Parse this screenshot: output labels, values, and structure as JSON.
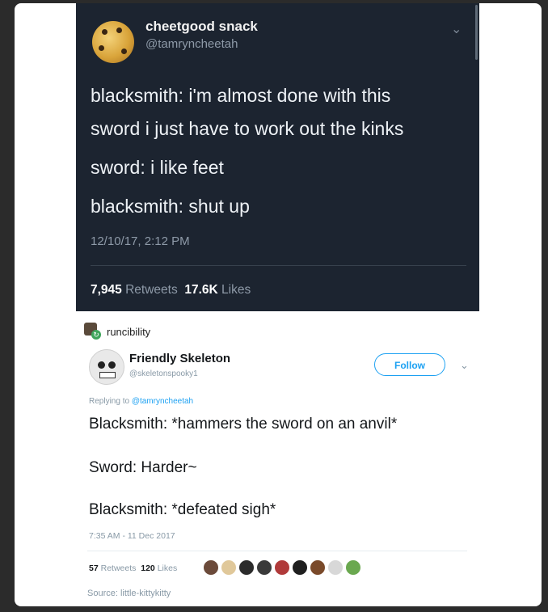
{
  "tweet1": {
    "name": "cheetgood snack",
    "handle": "@tamryncheetah",
    "lines": [
      "blacksmith: i'm almost done with this",
      "sword i just have to work out the kinks",
      "sword: i like feet",
      "blacksmith: shut up"
    ],
    "timestamp": "12/10/17, 2:12 PM",
    "retweets_count": "7,945",
    "retweets_label": "Retweets",
    "likes_count": "17.6K",
    "likes_label": "Likes",
    "menu_icon": "chevron-down-icon"
  },
  "reblog": {
    "username": "runcibility",
    "icon": "reblog-icon"
  },
  "tweet2": {
    "name": "Friendly Skeleton",
    "handle": "@skeletonspooky1",
    "follow_label": "Follow",
    "replying_prefix": "Replying to ",
    "replying_to": "@tamryncheetah",
    "lines": [
      "Blacksmith: *hammers the sword on an anvil*",
      "Sword: Harder~",
      "Blacksmith: *defeated sigh*"
    ],
    "timestamp": "7:35 AM - 11 Dec 2017",
    "retweets_count": "57",
    "retweets_label": "Retweets",
    "likes_count": "120",
    "likes_label": "Likes",
    "liker_colors": [
      "#6b4a3a",
      "#e0c89a",
      "#2b2b2b",
      "#3a3a3a",
      "#b03a3a",
      "#1f1f1f",
      "#7a4a2a",
      "#d8d8d8",
      "#6aa84f"
    ]
  },
  "source": "Source: little-kittykitty",
  "colors": {
    "dark_bg": "#1c2430",
    "link_blue": "#1da1f2"
  }
}
